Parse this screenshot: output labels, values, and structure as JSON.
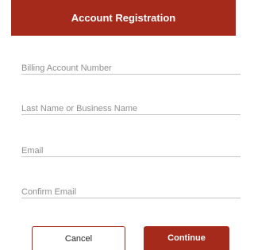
{
  "header": {
    "title": "Account Registration"
  },
  "form": {
    "billing_account_number": {
      "placeholder": "Billing Account Number",
      "value": ""
    },
    "last_name": {
      "placeholder": "Last Name or Business Name",
      "value": ""
    },
    "email": {
      "placeholder": "Email",
      "value": ""
    },
    "confirm_email": {
      "placeholder": "Confirm Email",
      "value": ""
    }
  },
  "actions": {
    "cancel_label": "Cancel",
    "continue_label": "Continue"
  },
  "colors": {
    "accent": "#a52a1c",
    "placeholder": "#8f8f8f",
    "underline": "#c6c6c6"
  }
}
